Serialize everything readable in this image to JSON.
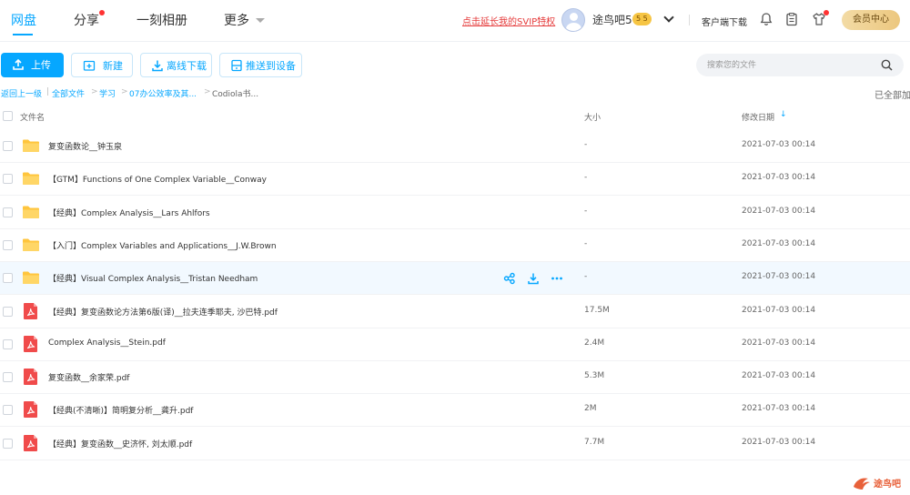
{
  "nav": {
    "tabs": [
      {
        "label": "网盘"
      },
      {
        "label": "分享"
      },
      {
        "label": "一刻相册"
      },
      {
        "label": "更多"
      }
    ],
    "promo": "点击延长我的SVIP特权",
    "username": "途鸟吧5",
    "vip_badge": "5 5",
    "client_download": "客户端下载",
    "member_center": "会员中心"
  },
  "toolbar": {
    "upload": "上传",
    "new": "新建",
    "offline_download": "离线下载",
    "push_to_device": "推送到设备",
    "search_placeholder": "搜索您的文件"
  },
  "breadcrumb": {
    "back": "返回上一级",
    "items": [
      "全部文件",
      "学习",
      "07办公效率及其...",
      "Codiola书..."
    ],
    "loaded_status": "已全部加"
  },
  "table": {
    "headers": {
      "name": "文件名",
      "size": "大小",
      "date": "修改日期"
    },
    "sort_column": "date",
    "rows": [
      {
        "type": "folder",
        "name": "复变函数论__钟玉泉",
        "size": "-",
        "date": "2021-07-03 00:14"
      },
      {
        "type": "folder",
        "name": "【GTM】Functions of One Complex Variable__Conway",
        "size": "-",
        "date": "2021-07-03 00:14"
      },
      {
        "type": "folder",
        "name": "【经典】Complex Analysis__Lars Ahlfors",
        "size": "-",
        "date": "2021-07-03 00:14"
      },
      {
        "type": "folder",
        "name": "【入门】Complex Variables and Applications__J.W.Brown",
        "size": "-",
        "date": "2021-07-03 00:14"
      },
      {
        "type": "folder",
        "name": "【经典】Visual Complex Analysis__Tristan Needham",
        "size": "-",
        "date": "2021-07-03 00:14",
        "hover": true
      },
      {
        "type": "pdf",
        "name": "【经典】复变函数论方法第6版(译)__拉夫连季耶夫, 沙巴特.pdf",
        "size": "17.5M",
        "date": "2021-07-03 00:14"
      },
      {
        "type": "pdf",
        "name": "Complex Analysis__Stein.pdf",
        "size": "2.4M",
        "date": "2021-07-03 00:14"
      },
      {
        "type": "pdf",
        "name": "复变函数__余家荣.pdf",
        "size": "5.3M",
        "date": "2021-07-03 00:14"
      },
      {
        "type": "pdf",
        "name": "【经典(不清晰)】简明复分析__龚升.pdf",
        "size": "2M",
        "date": "2021-07-03 00:14"
      },
      {
        "type": "pdf",
        "name": "【经典】复变函数__史济怀, 刘太顺.pdf",
        "size": "7.7M",
        "date": "2021-07-03 00:14"
      }
    ]
  },
  "watermark": "途鸟吧",
  "colors": {
    "accent": "#06a7ff",
    "folder": "#ffc53d",
    "pdf": "#f04b4b",
    "promo": "#e53b3b"
  }
}
